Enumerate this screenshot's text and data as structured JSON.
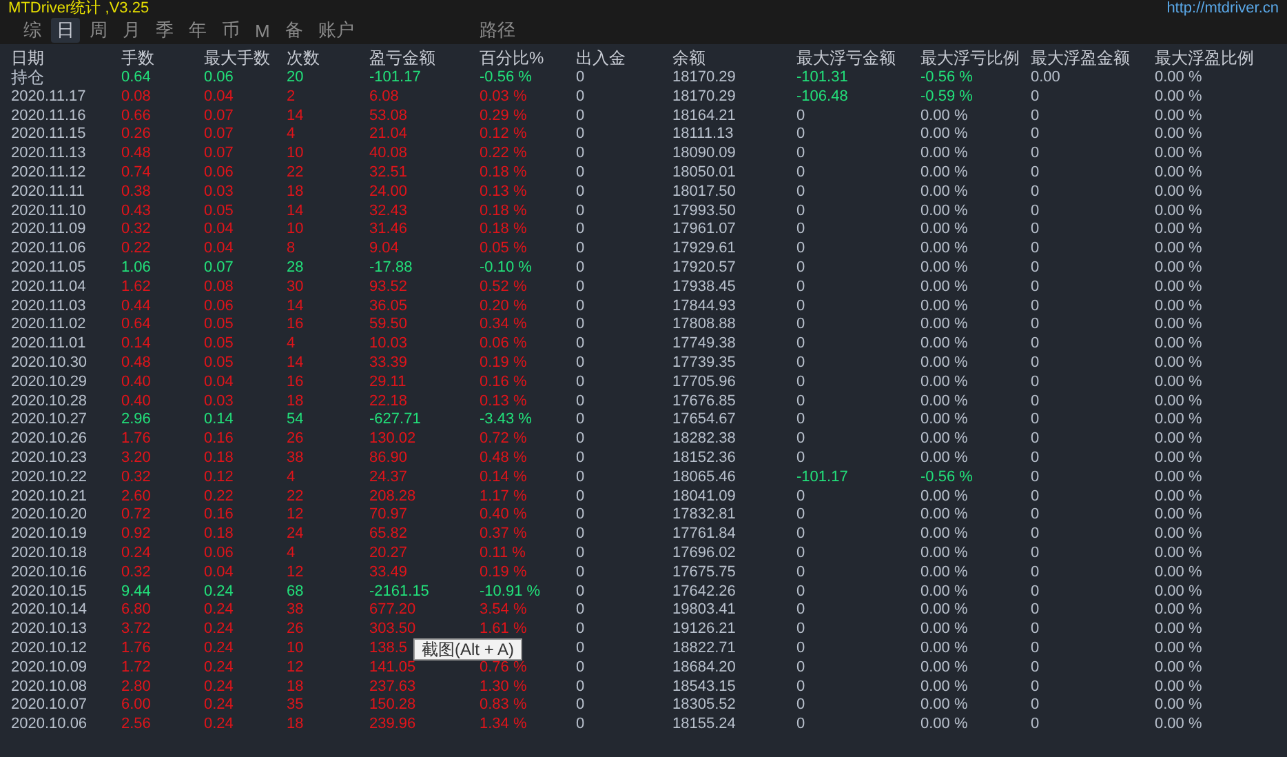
{
  "window": {
    "title": "MTDriver统计 ,V3.25",
    "link": "http://mtdriver.cn"
  },
  "tabs": [
    {
      "label": "综",
      "selected": false
    },
    {
      "label": "日",
      "selected": true
    },
    {
      "label": "周",
      "selected": false
    },
    {
      "label": "月",
      "selected": false
    },
    {
      "label": "季",
      "selected": false
    },
    {
      "label": "年",
      "selected": false
    },
    {
      "label": "币",
      "selected": false
    },
    {
      "label": "M",
      "selected": false
    },
    {
      "label": "备",
      "selected": false
    },
    {
      "label": "账户",
      "selected": false
    }
  ],
  "path_label": "路径",
  "table": {
    "columns": [
      "日期",
      "手数",
      "最大手数",
      "次数",
      "盈亏金额",
      "百分比%",
      "出入金",
      "余额",
      "最大浮亏金额",
      "最大浮亏比例",
      "最大浮盈金额",
      "最大浮盈比例"
    ],
    "rows": [
      {
        "kind": "negative",
        "float_loss": true,
        "cells": [
          "持仓",
          "0.64",
          "0.06",
          "20",
          "-101.17",
          "-0.56 %",
          "0",
          "18170.29",
          "-101.31",
          "-0.56 %",
          "0.00",
          "0.00 %"
        ]
      },
      {
        "kind": "positive",
        "float_loss": true,
        "cells": [
          "2020.11.17",
          "0.08",
          "0.04",
          "2",
          "6.08",
          "0.03 %",
          "0",
          "18170.29",
          "-106.48",
          "-0.59 %",
          "0",
          "0.00 %"
        ]
      },
      {
        "kind": "positive",
        "float_loss": false,
        "cells": [
          "2020.11.16",
          "0.66",
          "0.07",
          "14",
          "53.08",
          "0.29 %",
          "0",
          "18164.21",
          "0",
          "0.00 %",
          "0",
          "0.00 %"
        ]
      },
      {
        "kind": "positive",
        "float_loss": false,
        "cells": [
          "2020.11.15",
          "0.26",
          "0.07",
          "4",
          "21.04",
          "0.12 %",
          "0",
          "18111.13",
          "0",
          "0.00 %",
          "0",
          "0.00 %"
        ]
      },
      {
        "kind": "positive",
        "float_loss": false,
        "cells": [
          "2020.11.13",
          "0.48",
          "0.07",
          "10",
          "40.08",
          "0.22 %",
          "0",
          "18090.09",
          "0",
          "0.00 %",
          "0",
          "0.00 %"
        ]
      },
      {
        "kind": "positive",
        "float_loss": false,
        "cells": [
          "2020.11.12",
          "0.74",
          "0.06",
          "22",
          "32.51",
          "0.18 %",
          "0",
          "18050.01",
          "0",
          "0.00 %",
          "0",
          "0.00 %"
        ]
      },
      {
        "kind": "positive",
        "float_loss": false,
        "cells": [
          "2020.11.11",
          "0.38",
          "0.03",
          "18",
          "24.00",
          "0.13 %",
          "0",
          "18017.50",
          "0",
          "0.00 %",
          "0",
          "0.00 %"
        ]
      },
      {
        "kind": "positive",
        "float_loss": false,
        "cells": [
          "2020.11.10",
          "0.43",
          "0.05",
          "14",
          "32.43",
          "0.18 %",
          "0",
          "17993.50",
          "0",
          "0.00 %",
          "0",
          "0.00 %"
        ]
      },
      {
        "kind": "positive",
        "float_loss": false,
        "cells": [
          "2020.11.09",
          "0.32",
          "0.04",
          "10",
          "31.46",
          "0.18 %",
          "0",
          "17961.07",
          "0",
          "0.00 %",
          "0",
          "0.00 %"
        ]
      },
      {
        "kind": "positive",
        "float_loss": false,
        "cells": [
          "2020.11.06",
          "0.22",
          "0.04",
          "8",
          "9.04",
          "0.05 %",
          "0",
          "17929.61",
          "0",
          "0.00 %",
          "0",
          "0.00 %"
        ]
      },
      {
        "kind": "negative",
        "float_loss": false,
        "cells": [
          "2020.11.05",
          "1.06",
          "0.07",
          "28",
          "-17.88",
          "-0.10 %",
          "0",
          "17920.57",
          "0",
          "0.00 %",
          "0",
          "0.00 %"
        ]
      },
      {
        "kind": "positive",
        "float_loss": false,
        "cells": [
          "2020.11.04",
          "1.62",
          "0.08",
          "30",
          "93.52",
          "0.52 %",
          "0",
          "17938.45",
          "0",
          "0.00 %",
          "0",
          "0.00 %"
        ]
      },
      {
        "kind": "positive",
        "float_loss": false,
        "cells": [
          "2020.11.03",
          "0.44",
          "0.06",
          "14",
          "36.05",
          "0.20 %",
          "0",
          "17844.93",
          "0",
          "0.00 %",
          "0",
          "0.00 %"
        ]
      },
      {
        "kind": "positive",
        "float_loss": false,
        "cells": [
          "2020.11.02",
          "0.64",
          "0.05",
          "16",
          "59.50",
          "0.34 %",
          "0",
          "17808.88",
          "0",
          "0.00 %",
          "0",
          "0.00 %"
        ]
      },
      {
        "kind": "positive",
        "float_loss": false,
        "cells": [
          "2020.11.01",
          "0.14",
          "0.05",
          "4",
          "10.03",
          "0.06 %",
          "0",
          "17749.38",
          "0",
          "0.00 %",
          "0",
          "0.00 %"
        ]
      },
      {
        "kind": "positive",
        "float_loss": false,
        "cells": [
          "2020.10.30",
          "0.48",
          "0.05",
          "14",
          "33.39",
          "0.19 %",
          "0",
          "17739.35",
          "0",
          "0.00 %",
          "0",
          "0.00 %"
        ]
      },
      {
        "kind": "positive",
        "float_loss": false,
        "cells": [
          "2020.10.29",
          "0.40",
          "0.04",
          "16",
          "29.11",
          "0.16 %",
          "0",
          "17705.96",
          "0",
          "0.00 %",
          "0",
          "0.00 %"
        ]
      },
      {
        "kind": "positive",
        "float_loss": false,
        "cells": [
          "2020.10.28",
          "0.40",
          "0.03",
          "18",
          "22.18",
          "0.13 %",
          "0",
          "17676.85",
          "0",
          "0.00 %",
          "0",
          "0.00 %"
        ]
      },
      {
        "kind": "negative",
        "float_loss": false,
        "cells": [
          "2020.10.27",
          "2.96",
          "0.14",
          "54",
          "-627.71",
          "-3.43 %",
          "0",
          "17654.67",
          "0",
          "0.00 %",
          "0",
          "0.00 %"
        ]
      },
      {
        "kind": "positive",
        "float_loss": false,
        "cells": [
          "2020.10.26",
          "1.76",
          "0.16",
          "26",
          "130.02",
          "0.72 %",
          "0",
          "18282.38",
          "0",
          "0.00 %",
          "0",
          "0.00 %"
        ]
      },
      {
        "kind": "positive",
        "float_loss": false,
        "cells": [
          "2020.10.23",
          "3.20",
          "0.18",
          "38",
          "86.90",
          "0.48 %",
          "0",
          "18152.36",
          "0",
          "0.00 %",
          "0",
          "0.00 %"
        ]
      },
      {
        "kind": "positive",
        "float_loss": true,
        "cells": [
          "2020.10.22",
          "0.32",
          "0.12",
          "4",
          "24.37",
          "0.14 %",
          "0",
          "18065.46",
          "-101.17",
          "-0.56 %",
          "0",
          "0.00 %"
        ]
      },
      {
        "kind": "positive",
        "float_loss": false,
        "cells": [
          "2020.10.21",
          "2.60",
          "0.22",
          "22",
          "208.28",
          "1.17 %",
          "0",
          "18041.09",
          "0",
          "0.00 %",
          "0",
          "0.00 %"
        ]
      },
      {
        "kind": "positive",
        "float_loss": false,
        "cells": [
          "2020.10.20",
          "0.72",
          "0.16",
          "12",
          "70.97",
          "0.40 %",
          "0",
          "17832.81",
          "0",
          "0.00 %",
          "0",
          "0.00 %"
        ]
      },
      {
        "kind": "positive",
        "float_loss": false,
        "cells": [
          "2020.10.19",
          "0.92",
          "0.18",
          "24",
          "65.82",
          "0.37 %",
          "0",
          "17761.84",
          "0",
          "0.00 %",
          "0",
          "0.00 %"
        ]
      },
      {
        "kind": "positive",
        "float_loss": false,
        "cells": [
          "2020.10.18",
          "0.24",
          "0.06",
          "4",
          "20.27",
          "0.11 %",
          "0",
          "17696.02",
          "0",
          "0.00 %",
          "0",
          "0.00 %"
        ]
      },
      {
        "kind": "positive",
        "float_loss": false,
        "cells": [
          "2020.10.16",
          "0.32",
          "0.04",
          "12",
          "33.49",
          "0.19 %",
          "0",
          "17675.75",
          "0",
          "0.00 %",
          "0",
          "0.00 %"
        ]
      },
      {
        "kind": "negative",
        "float_loss": false,
        "cells": [
          "2020.10.15",
          "9.44",
          "0.24",
          "68",
          "-2161.15",
          "-10.91 %",
          "0",
          "17642.26",
          "0",
          "0.00 %",
          "0",
          "0.00 %"
        ]
      },
      {
        "kind": "positive",
        "float_loss": false,
        "cells": [
          "2020.10.14",
          "6.80",
          "0.24",
          "38",
          "677.20",
          "3.54 %",
          "0",
          "19803.41",
          "0",
          "0.00 %",
          "0",
          "0.00 %"
        ]
      },
      {
        "kind": "positive",
        "float_loss": false,
        "cells": [
          "2020.10.13",
          "3.72",
          "0.24",
          "26",
          "303.50",
          "1.61 %",
          "0",
          "19126.21",
          "0",
          "0.00 %",
          "0",
          "0.00 %"
        ]
      },
      {
        "kind": "positive",
        "float_loss": false,
        "cells": [
          "2020.10.12",
          "1.76",
          "0.24",
          "10",
          "138.5",
          null,
          "0",
          "18822.71",
          "0",
          "0.00 %",
          "0",
          "0.00 %"
        ]
      },
      {
        "kind": "positive",
        "float_loss": false,
        "cells": [
          "2020.10.09",
          "1.72",
          "0.24",
          "12",
          "141.05",
          "0.76 %",
          "0",
          "18684.20",
          "0",
          "0.00 %",
          "0",
          "0.00 %"
        ]
      },
      {
        "kind": "positive",
        "float_loss": false,
        "cells": [
          "2020.10.08",
          "2.80",
          "0.24",
          "18",
          "237.63",
          "1.30 %",
          "0",
          "18543.15",
          "0",
          "0.00 %",
          "0",
          "0.00 %"
        ]
      },
      {
        "kind": "positive",
        "float_loss": false,
        "cells": [
          "2020.10.07",
          "6.00",
          "0.24",
          "35",
          "150.28",
          "0.83 %",
          "0",
          "18305.52",
          "0",
          "0.00 %",
          "0",
          "0.00 %"
        ]
      },
      {
        "kind": "positive",
        "float_loss": false,
        "cells": [
          "2020.10.06",
          "2.56",
          "0.24",
          "18",
          "239.96",
          "1.34 %",
          "0",
          "18155.24",
          "0",
          "0.00 %",
          "0",
          "0.00 %"
        ]
      }
    ]
  },
  "tooltip": "截图(Alt + A)"
}
